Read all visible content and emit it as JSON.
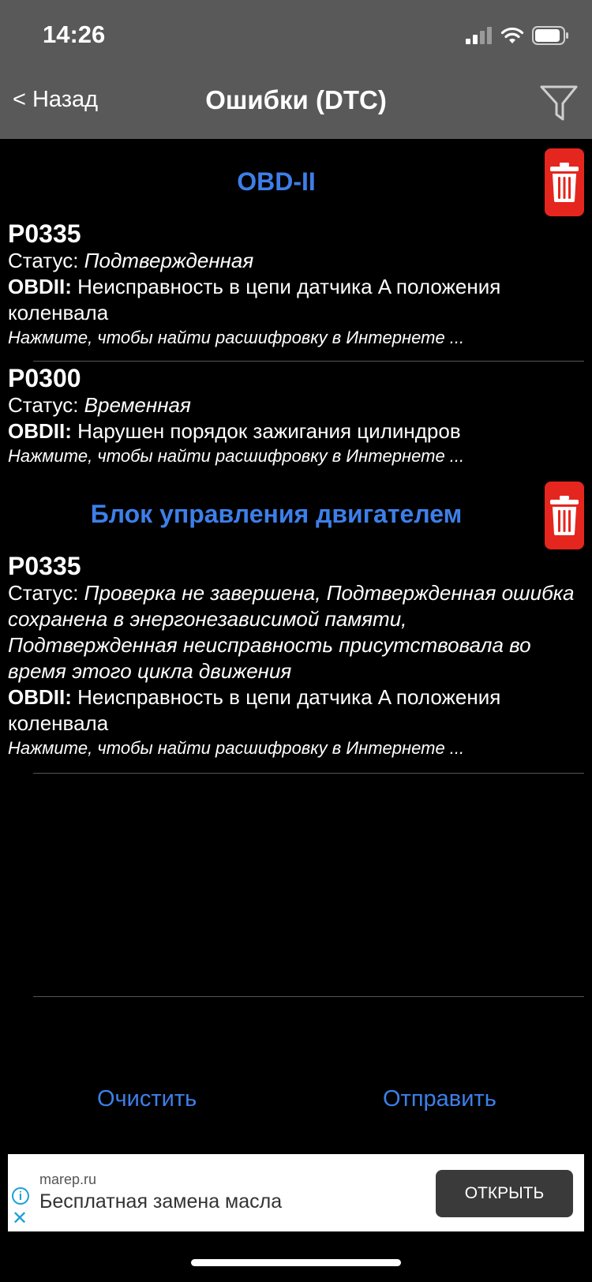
{
  "status_bar": {
    "time": "14:26"
  },
  "nav": {
    "back_label": "< Назад",
    "title": "Ошибки (DTC)"
  },
  "sections": [
    {
      "title": "OBD-II",
      "codes": [
        {
          "code": "P0335",
          "status_label": "Статус: ",
          "status": "Подтвержденная",
          "desc_label": "OBDII:",
          "desc": " Неисправность в цепи датчика A положения коленвала",
          "hint": "Нажмите, чтобы найти расшифровку в Интернете ..."
        },
        {
          "code": "P0300",
          "status_label": "Статус: ",
          "status": "Временная",
          "desc_label": "OBDII:",
          "desc": " Нарушен порядок зажигания цилиндров",
          "hint": "Нажмите, чтобы найти расшифровку в Интернете ..."
        }
      ]
    },
    {
      "title": "Блок управления двигателем",
      "codes": [
        {
          "code": "P0335",
          "status_label": "Статус: ",
          "status": "Проверка не завершена, Подтвержденная ошибка сохранена в энергонезависимой памяти, Подтвержденная неисправность присутствовала во время этого цикла движения",
          "desc_label": "OBDII:",
          "desc": " Неисправность в цепи датчика A положения коленвала",
          "hint": "Нажмите, чтобы найти расшифровку в Интернете ..."
        }
      ]
    }
  ],
  "actions": {
    "clear": "Очистить",
    "send": "Отправить"
  },
  "ad": {
    "info_glyph": "i",
    "close_glyph": "✕",
    "domain": "marep.ru",
    "headline": "Бесплатная замена масла",
    "cta": "ОТКРЫТЬ"
  },
  "colors": {
    "accent": "#3d7fe9",
    "trash": "#e5261e",
    "topbar": "#595959"
  },
  "icons": {
    "filter": "filter-icon",
    "trash": "trash-icon",
    "wifi": "wifi-icon",
    "battery": "battery-icon",
    "signal": "signal-icon"
  }
}
